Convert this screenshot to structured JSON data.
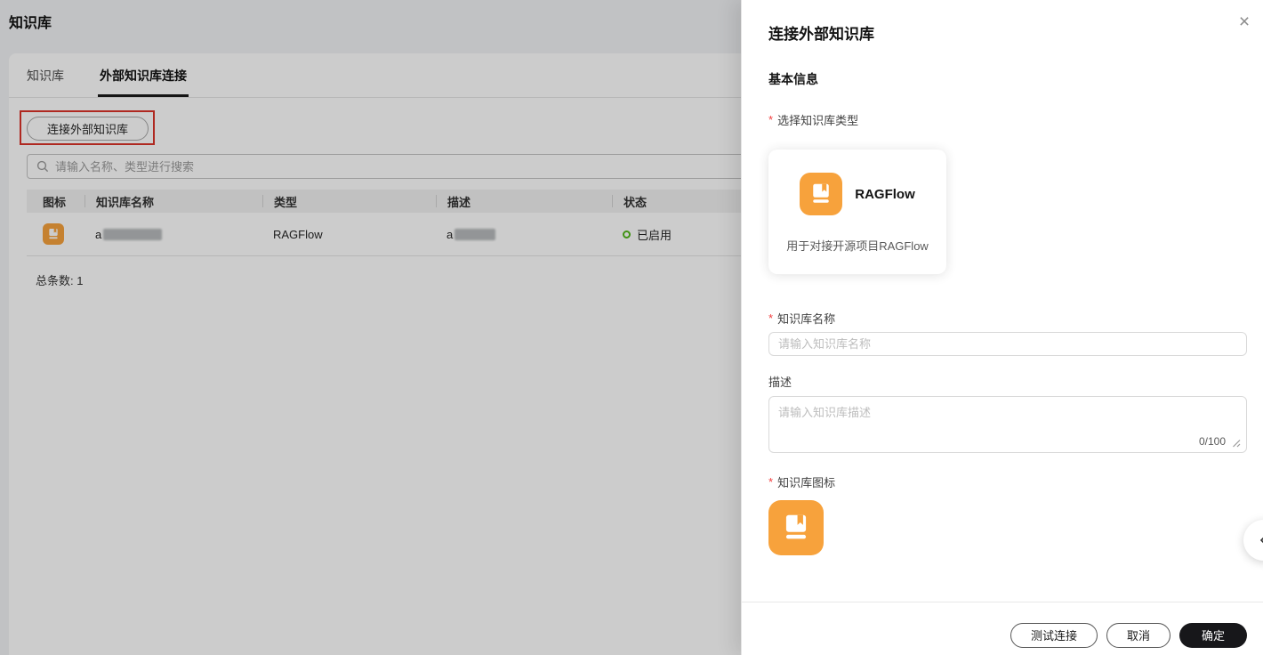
{
  "page": {
    "title": "知识库"
  },
  "tabs": [
    {
      "label": "知识库"
    },
    {
      "label": "外部知识库连接"
    }
  ],
  "toolbar": {
    "connect_button": "连接外部知识库"
  },
  "search": {
    "placeholder": "请输入名称、类型进行搜索"
  },
  "table": {
    "columns": [
      "图标",
      "知识库名称",
      "类型",
      "描述",
      "状态"
    ],
    "row": {
      "name_visible": "a",
      "type": "RAGFlow",
      "desc_visible": "a",
      "status": "已启用"
    },
    "total_label": "总条数:",
    "total_value": "1"
  },
  "drawer": {
    "title": "连接外部知识库",
    "close_icon": "×",
    "section_basic": "基本信息",
    "required_mark": "*",
    "fields": {
      "type": {
        "label": "选择知识库类型",
        "card": {
          "name": "RAGFlow",
          "desc": "用于对接开源项目RAGFlow"
        }
      },
      "name": {
        "label": "知识库名称",
        "placeholder": "请输入知识库名称"
      },
      "desc": {
        "label": "描述",
        "placeholder": "请输入知识库描述",
        "counter": "0/100"
      },
      "icon": {
        "label": "知识库图标"
      }
    },
    "footer": {
      "test_button": "测试连接",
      "cancel_button": "取消",
      "confirm_button": "确定"
    }
  },
  "colors": {
    "accent_orange": "#F7A23C",
    "status_green": "#52B81B",
    "annotation_red": "#DB3328",
    "confirm_black": "#17171A"
  }
}
